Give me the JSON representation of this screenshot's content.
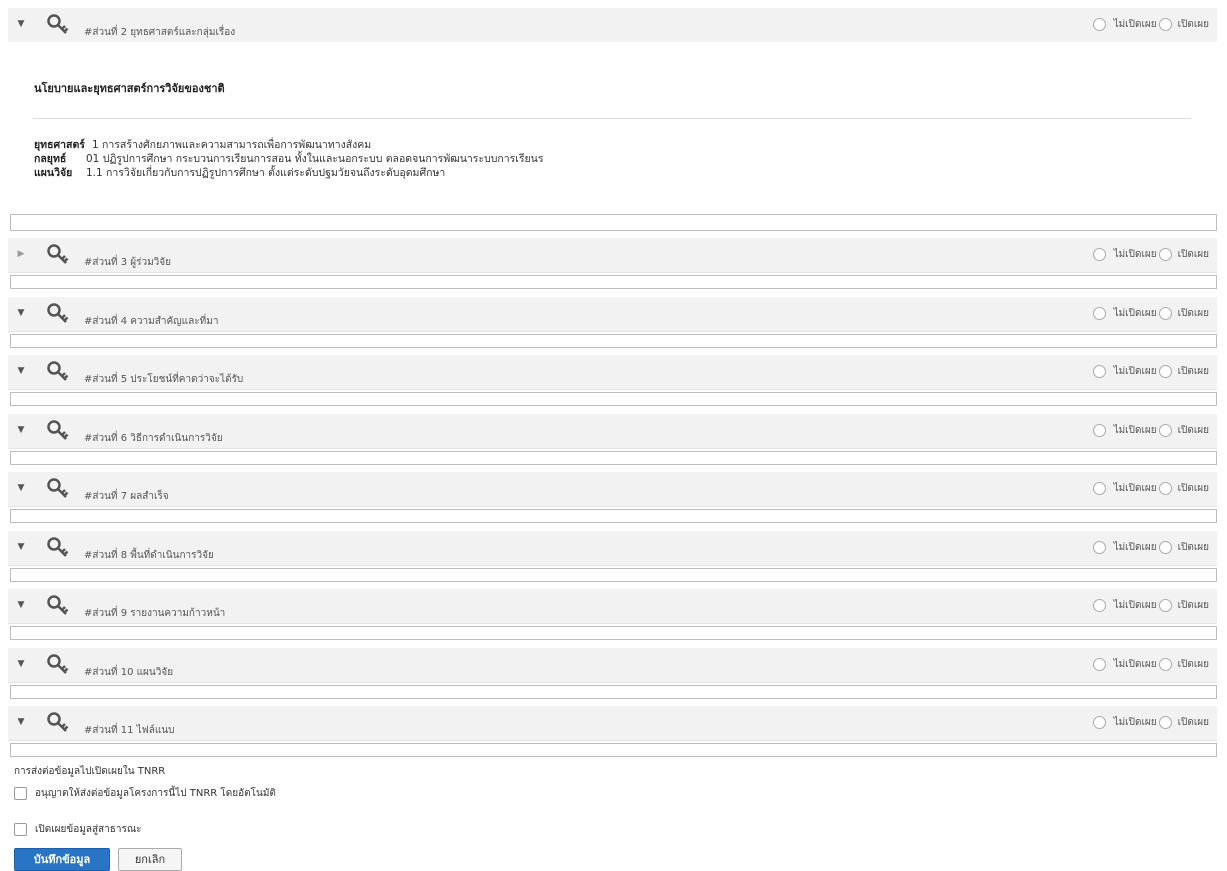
{
  "sections": [
    {
      "title": "#ส่วนที่ 2 ยุทธศาสตร์และกลุ่มเรื่อง",
      "expanded": true,
      "option_private": "ไม่เปิดเผย",
      "option_public": "เปิดเผย"
    },
    {
      "title": "#ส่วนที่ 3 ผู้ร่วมวิจัย",
      "expanded": false,
      "option_private": "ไม่เปิดเผย",
      "option_public": "เปิดเผย"
    },
    {
      "title": "#ส่วนที่ 4 ความสำคัญและที่มา",
      "expanded": true,
      "option_private": "ไม่เปิดเผย",
      "option_public": "เปิดเผย"
    },
    {
      "title": "#ส่วนที่ 5 ประโยชน์ที่คาดว่าจะได้รับ",
      "expanded": true,
      "option_private": "ไม่เปิดเผย",
      "option_public": "เปิดเผย"
    },
    {
      "title": "#ส่วนที่ 6 วิธีการดำเนินการวิจัย",
      "expanded": true,
      "option_private": "ไม่เปิดเผย",
      "option_public": "เปิดเผย"
    },
    {
      "title": "#ส่วนที่ 7 ผลสำเร็จ",
      "expanded": true,
      "option_private": "ไม่เปิดเผย",
      "option_public": "เปิดเผย"
    },
    {
      "title": "#ส่วนที่ 8 พื้นที่ดำเนินการวิจัย",
      "expanded": true,
      "option_private": "ไม่เปิดเผย",
      "option_public": "เปิดเผย"
    },
    {
      "title": "#ส่วนที่ 9 รายงานความก้าวหน้า",
      "expanded": true,
      "option_private": "ไม่เปิดเผย",
      "option_public": "เปิดเผย"
    },
    {
      "title": "#ส่วนที่ 10 แผนวิจัย",
      "expanded": true,
      "option_private": "ไม่เปิดเผย",
      "option_public": "เปิดเผย"
    },
    {
      "title": "#ส่วนที่ 11 ไฟล์แนบ",
      "expanded": true,
      "option_private": "ไม่เปิดเผย",
      "option_public": "เปิดเผย"
    }
  ],
  "strategy": {
    "heading": "นโยบายและยุทธศาสตร์การวิจัยของชาติ",
    "rows": [
      {
        "label": "ยุทธศาสตร์",
        "value": "1 การสร้างศักยภาพและความสามารถเพื่อการพัฒนาทางสังคม"
      },
      {
        "label": "กลยุทธ์",
        "value": "01 ปฏิรูปการศึกษา กระบวนการเรียนการสอน ทั้งในและนอกระบบ ตลอดจนการพัฒนาระบบการเรียนร"
      },
      {
        "label": "แผนวิจัย",
        "value": "1.1 การวิจัยเกี่ยวกับการปฏิรูปการศึกษา ตั้งแต่ระดับปฐมวัยจนถึงระดับอุดมศึกษา"
      }
    ]
  },
  "footer": {
    "tnrr_heading": "การส่งต่อข้อมูลไปเปิดเผยใน TNRR",
    "tnrr_checkbox": "อนุญาตให้ส่งต่อข้อมูลโครงการนี้ไป TNRR โดยอัตโนมัติ",
    "public_checkbox": "เปิดเผยข้อมูลสู่สาธารณะ",
    "save_label": "บันทึกข้อมูล",
    "cancel_label": "ยกเลิก"
  },
  "colors": {
    "save_button": "#2a74c6",
    "header_bg": "#f2f2f2"
  }
}
